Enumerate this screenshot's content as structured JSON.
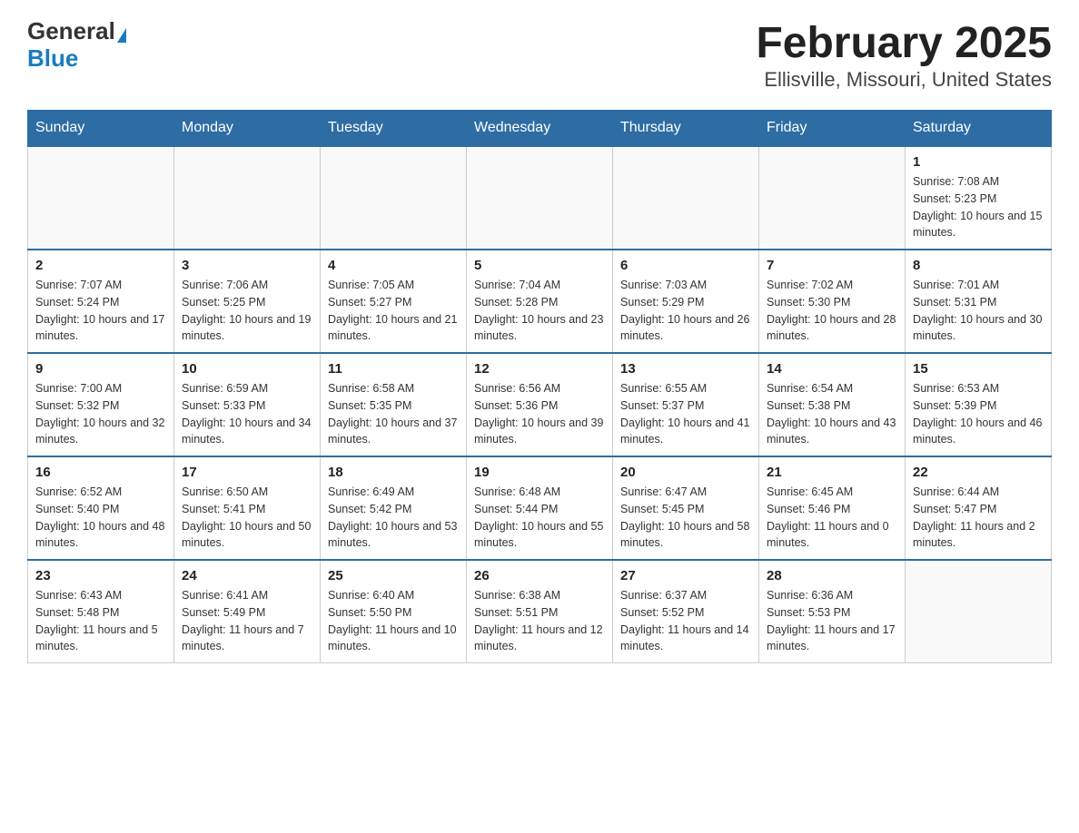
{
  "header": {
    "logo_general": "General",
    "logo_blue": "Blue",
    "title": "February 2025",
    "subtitle": "Ellisville, Missouri, United States"
  },
  "days_of_week": [
    "Sunday",
    "Monday",
    "Tuesday",
    "Wednesday",
    "Thursday",
    "Friday",
    "Saturday"
  ],
  "weeks": [
    [
      {
        "day": "",
        "info": ""
      },
      {
        "day": "",
        "info": ""
      },
      {
        "day": "",
        "info": ""
      },
      {
        "day": "",
        "info": ""
      },
      {
        "day": "",
        "info": ""
      },
      {
        "day": "",
        "info": ""
      },
      {
        "day": "1",
        "info": "Sunrise: 7:08 AM\nSunset: 5:23 PM\nDaylight: 10 hours and 15 minutes."
      }
    ],
    [
      {
        "day": "2",
        "info": "Sunrise: 7:07 AM\nSunset: 5:24 PM\nDaylight: 10 hours and 17 minutes."
      },
      {
        "day": "3",
        "info": "Sunrise: 7:06 AM\nSunset: 5:25 PM\nDaylight: 10 hours and 19 minutes."
      },
      {
        "day": "4",
        "info": "Sunrise: 7:05 AM\nSunset: 5:27 PM\nDaylight: 10 hours and 21 minutes."
      },
      {
        "day": "5",
        "info": "Sunrise: 7:04 AM\nSunset: 5:28 PM\nDaylight: 10 hours and 23 minutes."
      },
      {
        "day": "6",
        "info": "Sunrise: 7:03 AM\nSunset: 5:29 PM\nDaylight: 10 hours and 26 minutes."
      },
      {
        "day": "7",
        "info": "Sunrise: 7:02 AM\nSunset: 5:30 PM\nDaylight: 10 hours and 28 minutes."
      },
      {
        "day": "8",
        "info": "Sunrise: 7:01 AM\nSunset: 5:31 PM\nDaylight: 10 hours and 30 minutes."
      }
    ],
    [
      {
        "day": "9",
        "info": "Sunrise: 7:00 AM\nSunset: 5:32 PM\nDaylight: 10 hours and 32 minutes."
      },
      {
        "day": "10",
        "info": "Sunrise: 6:59 AM\nSunset: 5:33 PM\nDaylight: 10 hours and 34 minutes."
      },
      {
        "day": "11",
        "info": "Sunrise: 6:58 AM\nSunset: 5:35 PM\nDaylight: 10 hours and 37 minutes."
      },
      {
        "day": "12",
        "info": "Sunrise: 6:56 AM\nSunset: 5:36 PM\nDaylight: 10 hours and 39 minutes."
      },
      {
        "day": "13",
        "info": "Sunrise: 6:55 AM\nSunset: 5:37 PM\nDaylight: 10 hours and 41 minutes."
      },
      {
        "day": "14",
        "info": "Sunrise: 6:54 AM\nSunset: 5:38 PM\nDaylight: 10 hours and 43 minutes."
      },
      {
        "day": "15",
        "info": "Sunrise: 6:53 AM\nSunset: 5:39 PM\nDaylight: 10 hours and 46 minutes."
      }
    ],
    [
      {
        "day": "16",
        "info": "Sunrise: 6:52 AM\nSunset: 5:40 PM\nDaylight: 10 hours and 48 minutes."
      },
      {
        "day": "17",
        "info": "Sunrise: 6:50 AM\nSunset: 5:41 PM\nDaylight: 10 hours and 50 minutes."
      },
      {
        "day": "18",
        "info": "Sunrise: 6:49 AM\nSunset: 5:42 PM\nDaylight: 10 hours and 53 minutes."
      },
      {
        "day": "19",
        "info": "Sunrise: 6:48 AM\nSunset: 5:44 PM\nDaylight: 10 hours and 55 minutes."
      },
      {
        "day": "20",
        "info": "Sunrise: 6:47 AM\nSunset: 5:45 PM\nDaylight: 10 hours and 58 minutes."
      },
      {
        "day": "21",
        "info": "Sunrise: 6:45 AM\nSunset: 5:46 PM\nDaylight: 11 hours and 0 minutes."
      },
      {
        "day": "22",
        "info": "Sunrise: 6:44 AM\nSunset: 5:47 PM\nDaylight: 11 hours and 2 minutes."
      }
    ],
    [
      {
        "day": "23",
        "info": "Sunrise: 6:43 AM\nSunset: 5:48 PM\nDaylight: 11 hours and 5 minutes."
      },
      {
        "day": "24",
        "info": "Sunrise: 6:41 AM\nSunset: 5:49 PM\nDaylight: 11 hours and 7 minutes."
      },
      {
        "day": "25",
        "info": "Sunrise: 6:40 AM\nSunset: 5:50 PM\nDaylight: 11 hours and 10 minutes."
      },
      {
        "day": "26",
        "info": "Sunrise: 6:38 AM\nSunset: 5:51 PM\nDaylight: 11 hours and 12 minutes."
      },
      {
        "day": "27",
        "info": "Sunrise: 6:37 AM\nSunset: 5:52 PM\nDaylight: 11 hours and 14 minutes."
      },
      {
        "day": "28",
        "info": "Sunrise: 6:36 AM\nSunset: 5:53 PM\nDaylight: 11 hours and 17 minutes."
      },
      {
        "day": "",
        "info": ""
      }
    ]
  ]
}
